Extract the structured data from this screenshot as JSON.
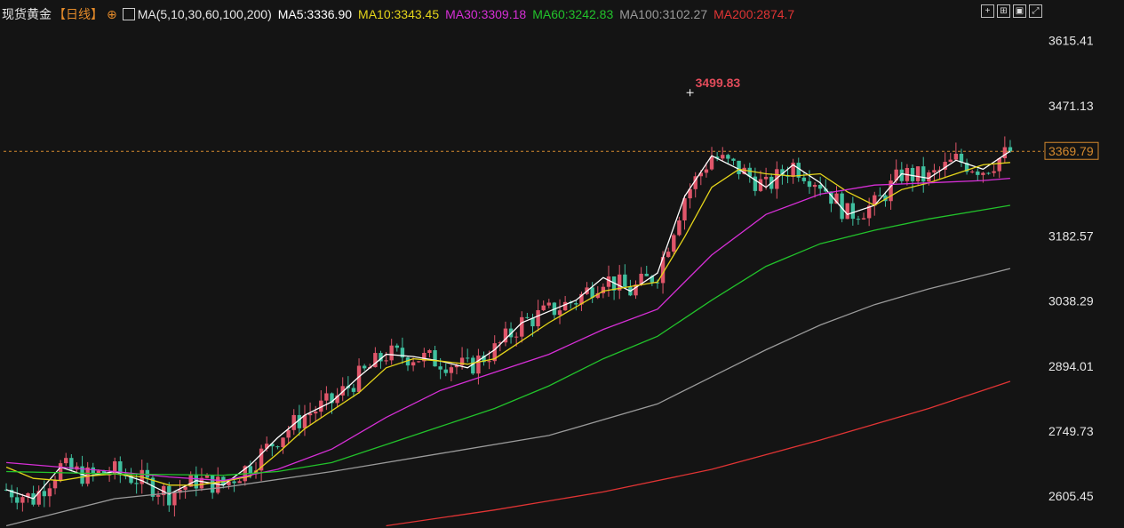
{
  "instrument": {
    "name": "现货黄金",
    "period": "【日线】",
    "indicator_icon": "chart-indicator-icon"
  },
  "legend": {
    "ma_params": "MA(5,10,30,60,100,200)",
    "items": [
      {
        "label": "MA5:3336.90",
        "color": "#ffffff"
      },
      {
        "label": "MA10:3343.45",
        "color": "#e5d51a"
      },
      {
        "label": "MA30:3309.18",
        "color": "#d62fd6"
      },
      {
        "label": "MA60:3242.83",
        "color": "#22c22b"
      },
      {
        "label": "MA100:3102.27",
        "color": "#9a9a9a"
      },
      {
        "label": "MA200:2874.7",
        "color": "#e03434"
      }
    ]
  },
  "toolbar": {
    "buttons": [
      {
        "name": "add-icon",
        "glyph": "+"
      },
      {
        "name": "layout-icon",
        "glyph": "⊞"
      },
      {
        "name": "fit-icon",
        "glyph": "▣"
      },
      {
        "name": "expand-icon",
        "glyph": "⤢"
      }
    ]
  },
  "colors": {
    "up": "#e0566a",
    "down": "#3fbf9f",
    "background": "#141414",
    "current_price_line": "#d4892e",
    "high_label": "#e04b5a"
  },
  "chart_data": {
    "type": "candlestick",
    "y_axis": {
      "ticks": [
        "3615.41",
        "3471.13",
        "3182.57",
        "3038.29",
        "2894.01",
        "2749.73",
        "2605.45"
      ],
      "range": [
        2535,
        3650
      ]
    },
    "current_price": "3369.79",
    "high_label": "3499.83",
    "ma_lines": {
      "MA5": [
        [
          0,
          2620
        ],
        [
          5,
          2600
        ],
        [
          10,
          2670
        ],
        [
          15,
          2650
        ],
        [
          20,
          2660
        ],
        [
          25,
          2640
        ],
        [
          30,
          2610
        ],
        [
          35,
          2640
        ],
        [
          40,
          2630
        ],
        [
          45,
          2675
        ],
        [
          50,
          2735
        ],
        [
          55,
          2785
        ],
        [
          60,
          2815
        ],
        [
          65,
          2870
        ],
        [
          70,
          2920
        ],
        [
          75,
          2915
        ],
        [
          80,
          2905
        ],
        [
          85,
          2890
        ],
        [
          90,
          2930
        ],
        [
          95,
          2990
        ],
        [
          100,
          3015
        ],
        [
          105,
          3040
        ],
        [
          110,
          3090
        ],
        [
          115,
          3060
        ],
        [
          120,
          3100
        ],
        [
          125,
          3270
        ],
        [
          130,
          3360
        ],
        [
          135,
          3330
        ],
        [
          140,
          3290
        ],
        [
          145,
          3340
        ],
        [
          150,
          3300
        ],
        [
          155,
          3230
        ],
        [
          160,
          3250
        ],
        [
          165,
          3320
        ],
        [
          170,
          3310
        ],
        [
          175,
          3350
        ],
        [
          180,
          3330
        ],
        [
          185,
          3370
        ]
      ],
      "MA10": [
        [
          0,
          2670
        ],
        [
          5,
          2645
        ],
        [
          10,
          2640
        ],
        [
          15,
          2650
        ],
        [
          20,
          2655
        ],
        [
          25,
          2648
        ],
        [
          30,
          2630
        ],
        [
          35,
          2630
        ],
        [
          40,
          2638
        ],
        [
          45,
          2650
        ],
        [
          50,
          2700
        ],
        [
          55,
          2755
        ],
        [
          60,
          2795
        ],
        [
          65,
          2835
        ],
        [
          70,
          2890
        ],
        [
          75,
          2910
        ],
        [
          80,
          2905
        ],
        [
          85,
          2898
        ],
        [
          90,
          2910
        ],
        [
          95,
          2950
        ],
        [
          100,
          2990
        ],
        [
          105,
          3025
        ],
        [
          110,
          3060
        ],
        [
          115,
          3070
        ],
        [
          120,
          3080
        ],
        [
          125,
          3180
        ],
        [
          130,
          3290
        ],
        [
          135,
          3330
        ],
        [
          140,
          3320
        ],
        [
          145,
          3315
        ],
        [
          150,
          3320
        ],
        [
          155,
          3280
        ],
        [
          160,
          3250
        ],
        [
          165,
          3285
        ],
        [
          170,
          3300
        ],
        [
          175,
          3320
        ],
        [
          180,
          3340
        ],
        [
          185,
          3345
        ]
      ],
      "MA30": [
        [
          0,
          2680
        ],
        [
          10,
          2670
        ],
        [
          20,
          2660
        ],
        [
          30,
          2648
        ],
        [
          40,
          2640
        ],
        [
          50,
          2665
        ],
        [
          60,
          2710
        ],
        [
          70,
          2780
        ],
        [
          80,
          2840
        ],
        [
          90,
          2880
        ],
        [
          100,
          2920
        ],
        [
          110,
          2975
        ],
        [
          120,
          3020
        ],
        [
          130,
          3140
        ],
        [
          140,
          3230
        ],
        [
          150,
          3275
        ],
        [
          160,
          3295
        ],
        [
          170,
          3300
        ],
        [
          180,
          3305
        ],
        [
          185,
          3310
        ]
      ],
      "MA60": [
        [
          0,
          2660
        ],
        [
          20,
          2655
        ],
        [
          40,
          2652
        ],
        [
          50,
          2660
        ],
        [
          60,
          2680
        ],
        [
          70,
          2720
        ],
        [
          80,
          2760
        ],
        [
          90,
          2800
        ],
        [
          100,
          2850
        ],
        [
          110,
          2910
        ],
        [
          120,
          2960
        ],
        [
          130,
          3040
        ],
        [
          140,
          3115
        ],
        [
          150,
          3165
        ],
        [
          160,
          3195
        ],
        [
          170,
          3220
        ],
        [
          180,
          3240
        ],
        [
          185,
          3250
        ]
      ],
      "MA100": [
        [
          0,
          2540
        ],
        [
          20,
          2600
        ],
        [
          40,
          2625
        ],
        [
          60,
          2660
        ],
        [
          80,
          2700
        ],
        [
          100,
          2740
        ],
        [
          120,
          2810
        ],
        [
          130,
          2870
        ],
        [
          140,
          2930
        ],
        [
          150,
          2985
        ],
        [
          160,
          3030
        ],
        [
          170,
          3065
        ],
        [
          180,
          3095
        ],
        [
          185,
          3110
        ]
      ],
      "MA200": [
        [
          70,
          2540
        ],
        [
          90,
          2575
        ],
        [
          110,
          2615
        ],
        [
          130,
          2665
        ],
        [
          150,
          2730
        ],
        [
          170,
          2800
        ],
        [
          185,
          2860
        ]
      ]
    }
  }
}
